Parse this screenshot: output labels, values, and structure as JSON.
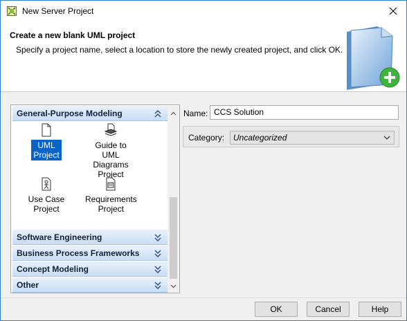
{
  "window": {
    "title": "New Server Project"
  },
  "header": {
    "title": "Create a new blank UML project",
    "description": "Specify a project name, select a location to store the newly created project, and click OK."
  },
  "groups": [
    {
      "label": "General-Purpose Modeling",
      "expanded": true
    },
    {
      "label": "Software Engineering",
      "expanded": false
    },
    {
      "label": "Business Process Frameworks",
      "expanded": false
    },
    {
      "label": "Concept Modeling",
      "expanded": false
    },
    {
      "label": "Other",
      "expanded": false
    }
  ],
  "tiles": [
    {
      "line1": "UML",
      "line2": "Project",
      "line3": "",
      "icon": "document-icon",
      "selected": true
    },
    {
      "line1": "Guide to",
      "line2": "UML Diagrams",
      "line3": "Project",
      "icon": "layers-icon",
      "selected": false
    },
    {
      "line1": "Use Case",
      "line2": "Project",
      "line3": "",
      "icon": "use-case-icon",
      "selected": false
    },
    {
      "line1": "Requirements",
      "line2": "Project",
      "line3": "",
      "icon": "requirements-icon",
      "selected": false
    }
  ],
  "form": {
    "name_label": "Name:",
    "name_value": "CCS Solution",
    "category_label": "Category:",
    "category_value": "Uncategorized"
  },
  "buttons": {
    "ok": "OK",
    "cancel": "Cancel",
    "help": "Help"
  },
  "colors": {
    "accent": "#0a64c8",
    "group_header": "#c8ddf5",
    "plus_green": "#3fb23f"
  }
}
